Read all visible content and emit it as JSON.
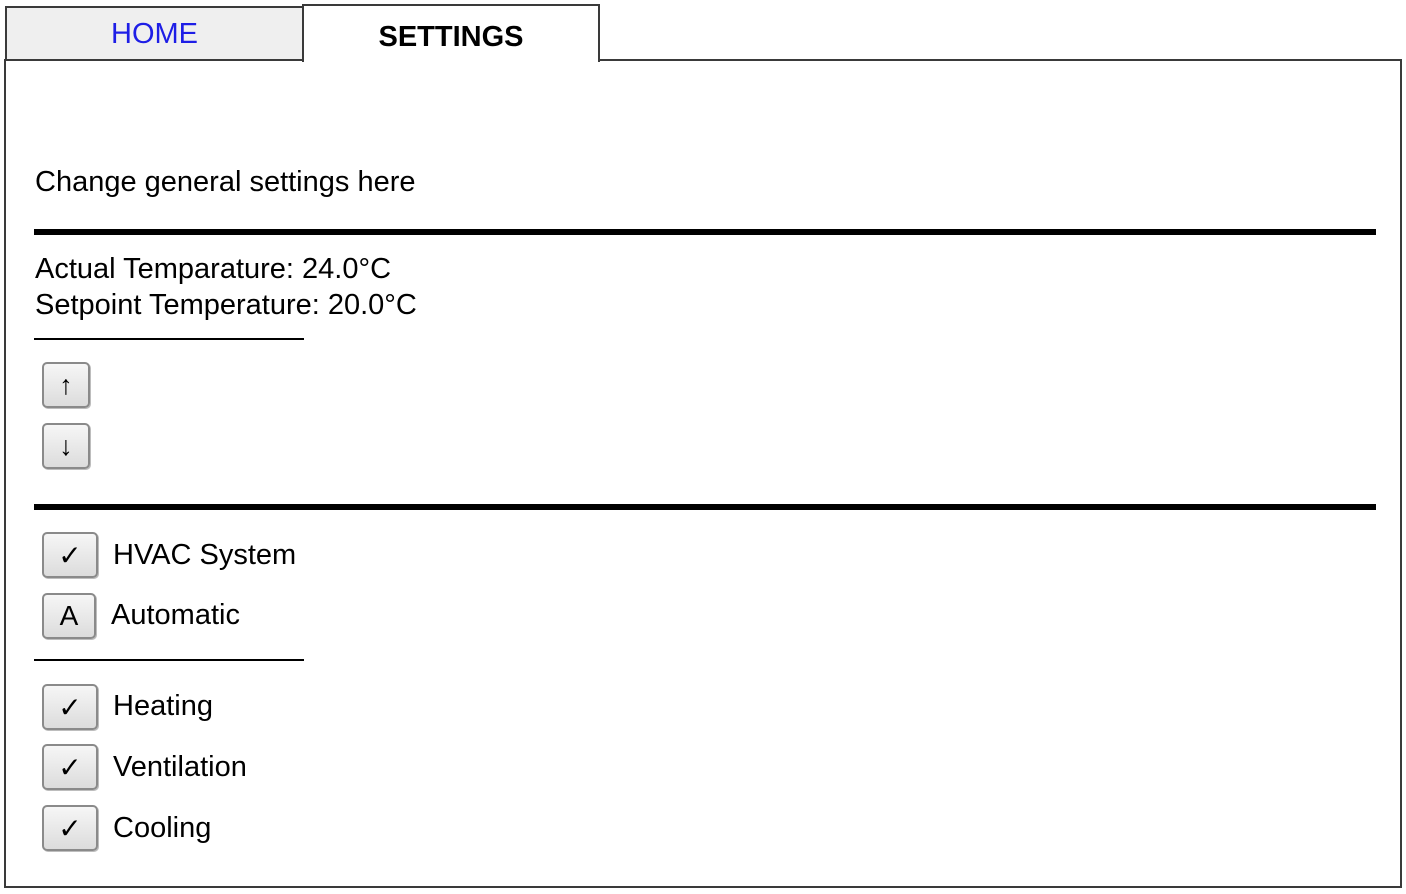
{
  "tabs": {
    "home": "HOME",
    "settings": "SETTINGS"
  },
  "intro": "Change general settings here",
  "temperature": {
    "actual": "Actual Temparature: 24.0°C",
    "setpoint": "Setpoint Temperature: 20.0°C",
    "up_symbol": "↑",
    "down_symbol": "↓"
  },
  "system": {
    "hvac": {
      "symbol": "✓",
      "label": "HVAC System"
    },
    "automatic": {
      "symbol": "A",
      "label": "Automatic"
    }
  },
  "modes": {
    "heating": {
      "symbol": "✓",
      "label": "Heating"
    },
    "ventilation": {
      "symbol": "✓",
      "label": "Ventilation"
    },
    "cooling": {
      "symbol": "✓",
      "label": "Cooling"
    }
  },
  "colors": {
    "active_tab_link": "#1e1ee6",
    "inactive_tab_bg": "#efefef"
  }
}
